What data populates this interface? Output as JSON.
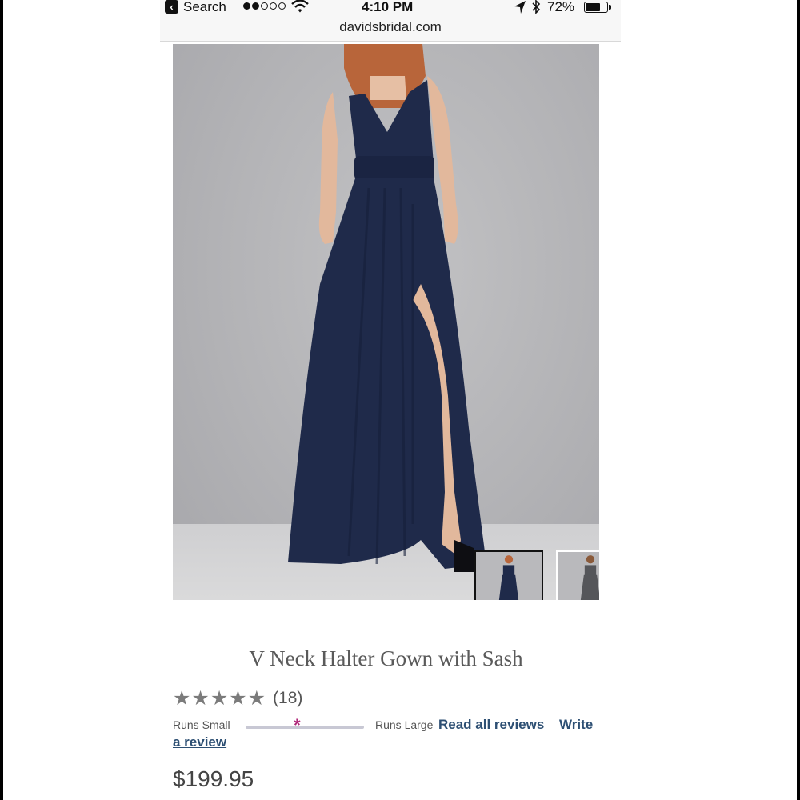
{
  "status_bar": {
    "back_label": "Search",
    "time": "4:10 PM",
    "battery": "72%",
    "battery_level": 0.72,
    "signal_bars_on": 2,
    "signal_bars_total": 5
  },
  "browser": {
    "url": "davidsbridal.com"
  },
  "gallery": {
    "dress_color": "#1f2a4a",
    "thumbnails": [
      {
        "name": "front-view",
        "selected": true,
        "dress_color": "#1f2a4a"
      },
      {
        "name": "back-view",
        "selected": false,
        "dress_color": "#55565a"
      }
    ]
  },
  "product": {
    "title": "V Neck Halter Gown with Sash",
    "stars": "★★★★★",
    "rating_of_5": 5,
    "review_count": "(18)",
    "fit": {
      "low_label": "Runs Small",
      "high_label": "Runs Large",
      "position_fraction": 0.46
    },
    "read_all_reviews": "Read all reviews",
    "write_a_review_part1": "Write",
    "write_a_review_part2": "a review",
    "price": "$199.95"
  },
  "colors": {
    "link": "#2d4f73",
    "fit_marker": "#b0287a",
    "star": "#7b7b7b"
  }
}
